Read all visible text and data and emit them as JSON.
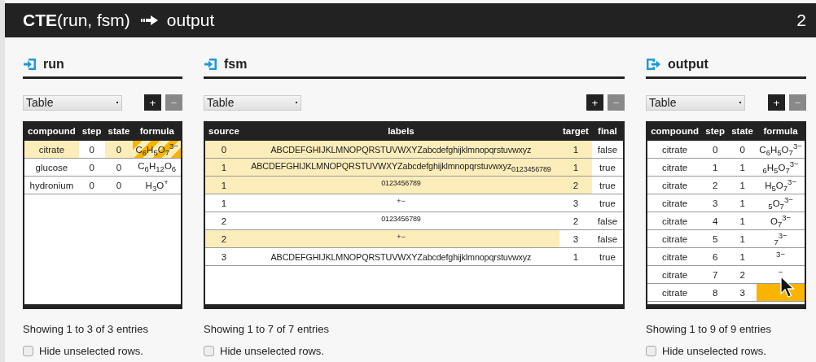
{
  "title": {
    "function": "CTE",
    "args": "(run, fsm)",
    "output": "output",
    "count": "2"
  },
  "panels": [
    {
      "name": "run",
      "kind": "input",
      "view": "Table",
      "buttons": [
        {
          "label": "+",
          "disabled": false
        },
        {
          "label": "−",
          "disabled": true
        }
      ],
      "columns": [
        "compound",
        "step",
        "state",
        "formula"
      ],
      "rows": [
        [
          {
            "text": "citrate",
            "highlighted": true,
            "focused": false
          },
          {
            "text": "0",
            "highlighted": false,
            "focused": false
          },
          {
            "text": "0",
            "highlighted": true,
            "focused": false
          },
          {
            "text": "C$_{6}$H$_{5}$O$_{7}$$^{3−}$",
            "highlighted": true,
            "focused": true
          }
        ],
        [
          {
            "text": "glucose",
            "highlighted": false,
            "focused": false
          },
          {
            "text": "0",
            "highlighted": false,
            "focused": false
          },
          {
            "text": "0",
            "highlighted": false,
            "focused": false
          },
          {
            "text": "C$_{6}$H$_{12}$O$_{6}$",
            "highlighted": false,
            "focused": false
          }
        ],
        [
          {
            "text": "hydronium",
            "highlighted": false,
            "focused": false
          },
          {
            "text": "0",
            "highlighted": false,
            "focused": false
          },
          {
            "text": "0",
            "highlighted": false,
            "focused": false
          },
          {
            "text": "H$_{3}$O$^{+}$",
            "highlighted": false,
            "focused": false
          }
        ]
      ],
      "footer": "Showing 1 to 3 of 3 entries",
      "hide_unselected": {
        "label": "Hide unselected rows.",
        "checked": false
      }
    },
    {
      "name": "fsm",
      "kind": "input",
      "view": "Table",
      "buttons": [
        {
          "label": "+",
          "disabled": false
        },
        {
          "label": "−",
          "disabled": true
        }
      ],
      "columns": [
        "source",
        "labels",
        "target",
        "final"
      ],
      "rows": [
        [
          {
            "text": "0",
            "highlighted": true,
            "focused": false
          },
          {
            "text": "ABCDEFGHIJKLMNOPQRSTUVWXYZabcdefghijklmnopqrstuvwxyz",
            "highlighted": true,
            "focused": false
          },
          {
            "text": "1",
            "highlighted": true,
            "focused": false
          },
          {
            "text": "false",
            "highlighted": false,
            "focused": false
          }
        ],
        [
          {
            "text": "1",
            "highlighted": true,
            "focused": false
          },
          {
            "text": "ABCDEFGHIJKLMNOPQRSTUVWXYZabcdefghijklmnopqrstuvwxyz$_{0123456789}$",
            "highlighted": true,
            "focused": false
          },
          {
            "text": "1",
            "highlighted": true,
            "focused": false
          },
          {
            "text": "true",
            "highlighted": false,
            "focused": false
          }
        ],
        [
          {
            "text": "1",
            "highlighted": true,
            "focused": false
          },
          {
            "text": "$^{0123456789}$",
            "highlighted": true,
            "focused": false
          },
          {
            "text": "2",
            "highlighted": true,
            "focused": false
          },
          {
            "text": "true",
            "highlighted": false,
            "focused": false
          }
        ],
        [
          {
            "text": "1",
            "highlighted": false,
            "focused": false
          },
          {
            "text": "$^{+−}$",
            "highlighted": false,
            "focused": false
          },
          {
            "text": "3",
            "highlighted": false,
            "focused": false
          },
          {
            "text": "true",
            "highlighted": false,
            "focused": false
          }
        ],
        [
          {
            "text": "2",
            "highlighted": false,
            "focused": false
          },
          {
            "text": "$^{0123456789}$",
            "highlighted": false,
            "focused": false
          },
          {
            "text": "2",
            "highlighted": false,
            "focused": false
          },
          {
            "text": "false",
            "highlighted": false,
            "focused": false
          }
        ],
        [
          {
            "text": "2",
            "highlighted": true,
            "focused": false
          },
          {
            "text": "$^{+−}$",
            "highlighted": true,
            "focused": false
          },
          {
            "text": "3",
            "highlighted": false,
            "focused": false
          },
          {
            "text": "false",
            "highlighted": false,
            "focused": false
          }
        ],
        [
          {
            "text": "3",
            "highlighted": false,
            "focused": false
          },
          {
            "text": "ABCDEFGHIJKLMNOPQRSTUVWXYZabcdefghijklmnopqrstuvwxyz",
            "highlighted": false,
            "focused": false
          },
          {
            "text": "1",
            "highlighted": false,
            "focused": false
          },
          {
            "text": "true",
            "highlighted": false,
            "focused": false
          }
        ]
      ],
      "footer": "Showing 1 to 7 of 7 entries",
      "hide_unselected": {
        "label": "Hide unselected rows.",
        "checked": false
      }
    },
    {
      "name": "output",
      "kind": "output",
      "view": "Table",
      "buttons": [
        {
          "label": "+",
          "disabled": false
        },
        {
          "label": "−",
          "disabled": true
        }
      ],
      "columns": [
        "compound",
        "step",
        "state",
        "formula"
      ],
      "rows": [
        [
          {
            "text": "citrate",
            "highlighted": false,
            "focused": false
          },
          {
            "text": "0",
            "highlighted": false,
            "focused": false
          },
          {
            "text": "0",
            "highlighted": false,
            "focused": false
          },
          {
            "text": "C$_{6}$H$_{5}$O$_{7}$$^{3−}$",
            "highlighted": false,
            "focused": false
          }
        ],
        [
          {
            "text": "citrate",
            "highlighted": false,
            "focused": false
          },
          {
            "text": "1",
            "highlighted": false,
            "focused": false
          },
          {
            "text": "1",
            "highlighted": false,
            "focused": false
          },
          {
            "text": "$_{6}$H$_{5}$O$_{7}$$^{3−}$",
            "highlighted": false,
            "focused": false
          }
        ],
        [
          {
            "text": "citrate",
            "highlighted": false,
            "focused": false
          },
          {
            "text": "2",
            "highlighted": false,
            "focused": false
          },
          {
            "text": "1",
            "highlighted": false,
            "focused": false
          },
          {
            "text": "H$_{5}$O$_{7}$$^{3−}$",
            "highlighted": false,
            "focused": false
          }
        ],
        [
          {
            "text": "citrate",
            "highlighted": false,
            "focused": false
          },
          {
            "text": "3",
            "highlighted": false,
            "focused": false
          },
          {
            "text": "1",
            "highlighted": false,
            "focused": false
          },
          {
            "text": "$_{5}$O$_{7}$$^{3−}$",
            "highlighted": false,
            "focused": false
          }
        ],
        [
          {
            "text": "citrate",
            "highlighted": false,
            "focused": false
          },
          {
            "text": "4",
            "highlighted": false,
            "focused": false
          },
          {
            "text": "1",
            "highlighted": false,
            "focused": false
          },
          {
            "text": "O$_{7}$$^{3−}$",
            "highlighted": false,
            "focused": false
          }
        ],
        [
          {
            "text": "citrate",
            "highlighted": false,
            "focused": false
          },
          {
            "text": "5",
            "highlighted": false,
            "focused": false
          },
          {
            "text": "1",
            "highlighted": false,
            "focused": false
          },
          {
            "text": "$_{7}$$^{3−}$",
            "highlighted": false,
            "focused": false
          }
        ],
        [
          {
            "text": "citrate",
            "highlighted": false,
            "focused": false
          },
          {
            "text": "6",
            "highlighted": false,
            "focused": false
          },
          {
            "text": "1",
            "highlighted": false,
            "focused": false
          },
          {
            "text": "$^{3−}$",
            "highlighted": false,
            "focused": false
          }
        ],
        [
          {
            "text": "citrate",
            "highlighted": false,
            "focused": false
          },
          {
            "text": "7",
            "highlighted": false,
            "focused": false
          },
          {
            "text": "2",
            "highlighted": false,
            "focused": false
          },
          {
            "text": "$^{−}$",
            "highlighted": false,
            "focused": false
          }
        ],
        [
          {
            "text": "citrate",
            "highlighted": false,
            "focused": false
          },
          {
            "text": "8",
            "highlighted": false,
            "focused": false
          },
          {
            "text": "3",
            "highlighted": false,
            "focused": false
          },
          {
            "highlighted": false,
            "focused": true
          }
        ]
      ],
      "footer": "Showing 1 to 9 of 9 entries",
      "hide_unselected": {
        "label": "Hide unselected rows.",
        "checked": false
      }
    }
  ]
}
